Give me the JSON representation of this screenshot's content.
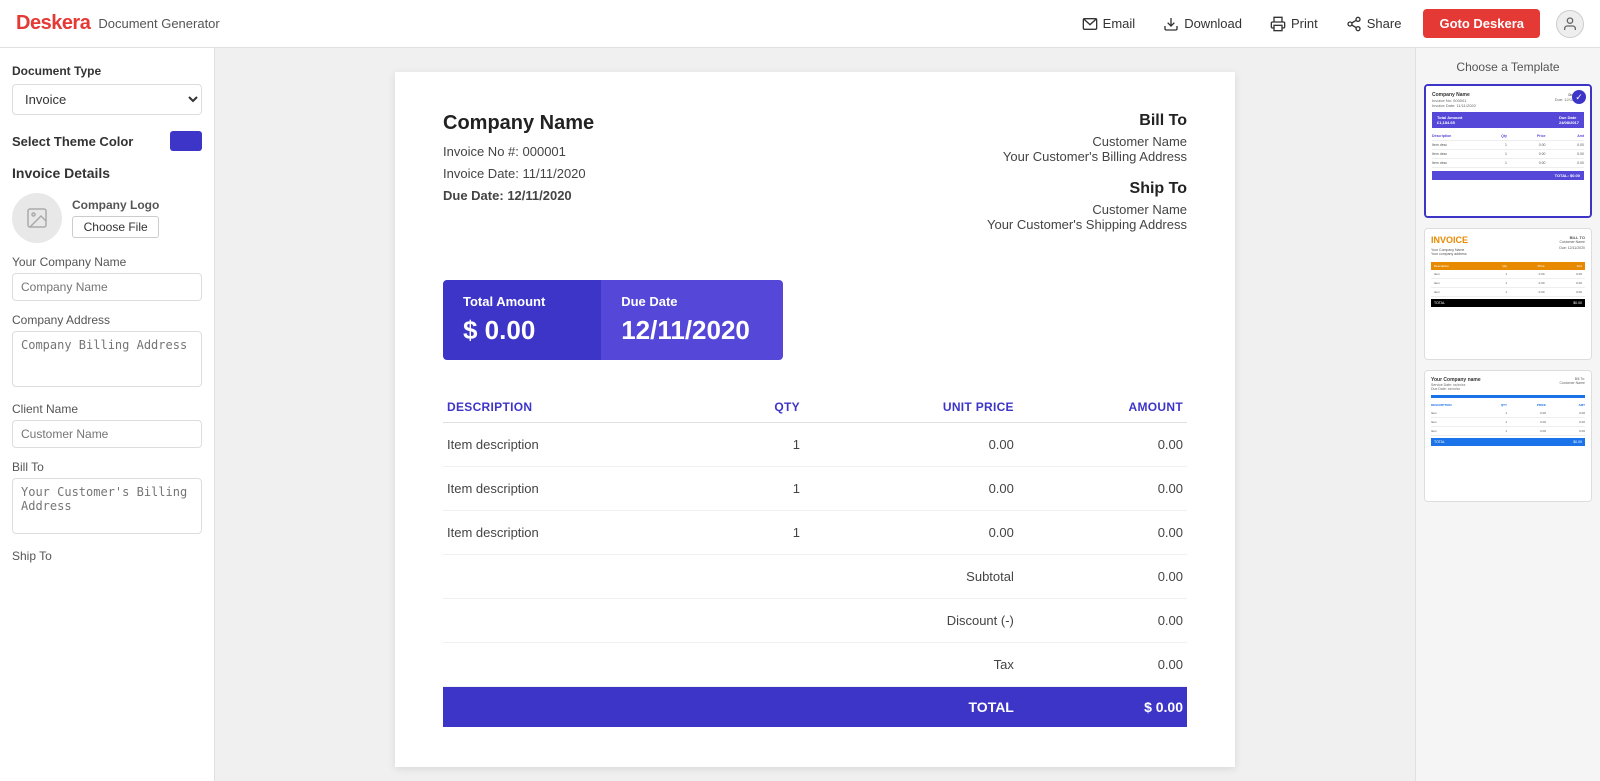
{
  "header": {
    "logo_text": "Deskera",
    "subtitle": "Document Generator",
    "email_label": "Email",
    "download_label": "Download",
    "print_label": "Print",
    "share_label": "Share",
    "goto_label": "Goto Deskera"
  },
  "sidebar": {
    "document_type_label": "Document Type",
    "document_type_value": "Invoice",
    "select_theme_label": "Select Theme Color",
    "theme_color": "#3d35c8",
    "invoice_details_label": "Invoice Details",
    "logo_label": "Company Logo",
    "choose_file_label": "Choose File",
    "company_name_label": "Your Company Name",
    "company_name_placeholder": "Company Name",
    "company_address_label": "Company Address",
    "company_address_placeholder": "Company Billing Address",
    "client_name_label": "Client Name",
    "client_name_placeholder": "Customer Name",
    "bill_to_label": "Bill To",
    "bill_to_placeholder": "Your Customer's Billing Address",
    "ship_to_label": "Ship To"
  },
  "invoice": {
    "company_name": "Company Name",
    "invoice_no_label": "Invoice No #:",
    "invoice_no": "000001",
    "invoice_date_label": "Invoice Date:",
    "invoice_date": "11/11/2020",
    "due_date_label": "Due Date:",
    "due_date": "12/11/2020",
    "bill_to_heading": "Bill To",
    "bill_to_name": "Customer Name",
    "bill_to_address": "Your Customer's Billing Address",
    "ship_to_heading": "Ship To",
    "ship_to_name": "Customer Name",
    "ship_to_address": "Your Customer's Shipping Address",
    "banner_total_label": "Total Amount",
    "banner_total_value": "$ 0.00",
    "banner_due_label": "Due Date",
    "banner_due_value": "12/11/2020",
    "table_headers": [
      "DESCRIPTION",
      "QTY",
      "UNIT PRICE",
      "AMOUNT"
    ],
    "table_rows": [
      {
        "description": "Item description",
        "qty": "1",
        "unit_price": "0.00",
        "amount": "0.00"
      },
      {
        "description": "Item description",
        "qty": "1",
        "unit_price": "0.00",
        "amount": "0.00"
      },
      {
        "description": "Item description",
        "qty": "1",
        "unit_price": "0.00",
        "amount": "0.00"
      }
    ],
    "subtotal_label": "Subtotal",
    "subtotal_value": "0.00",
    "discount_label": "Discount (-)",
    "discount_value": "0.00",
    "tax_label": "Tax",
    "tax_value": "0.00",
    "total_label": "TOTAL",
    "total_value": "$ 0.00"
  },
  "right_sidebar": {
    "choose_template_label": "Choose a Template",
    "templates": [
      {
        "id": "t1",
        "selected": true
      },
      {
        "id": "t2",
        "selected": false
      },
      {
        "id": "t3",
        "selected": false
      }
    ]
  }
}
